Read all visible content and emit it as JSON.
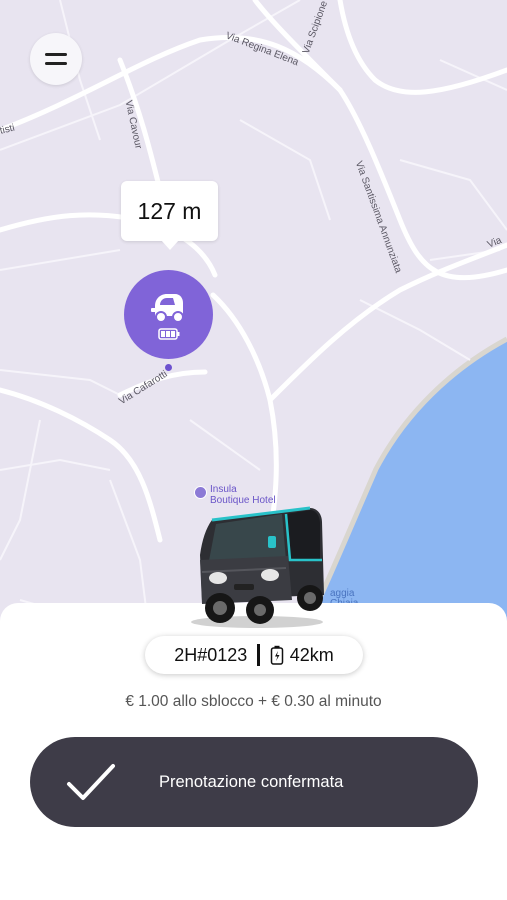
{
  "map": {
    "streets": [
      {
        "name": "Via Regina Elena"
      },
      {
        "name": "Via Scipione"
      },
      {
        "name": "Via Cavour"
      },
      {
        "name": "tisti"
      },
      {
        "name": "Via Santissima Annunziata"
      },
      {
        "name": "Via"
      },
      {
        "name": "Via Cafarotti"
      },
      {
        "name": "aggia"
      },
      {
        "name": "Chiaia"
      }
    ],
    "poi": {
      "line1": "Insula",
      "line2": "Boutique Hotel",
      "icon": "hotel-pin-icon"
    },
    "colors": {
      "land": "#e8e4f0",
      "water": "#8cb6f2",
      "road": "#ffffff",
      "marker": "#8064d8"
    }
  },
  "menu": {
    "icon": "hamburger-menu-icon"
  },
  "distance": {
    "text": "127 m"
  },
  "vehicle_marker": {
    "icon": "car-icon",
    "battery_icon": "battery-icon"
  },
  "vehicle": {
    "plate": "2H#0123",
    "range": "42km",
    "image": "electric-microcar-photo"
  },
  "pricing": {
    "text": "€ 1.00 allo sblocco + € 0.30 al minuto"
  },
  "confirm_button": {
    "label": "Prenotazione confermata",
    "icon": "checkmark-icon",
    "color": "#3e3c48"
  }
}
